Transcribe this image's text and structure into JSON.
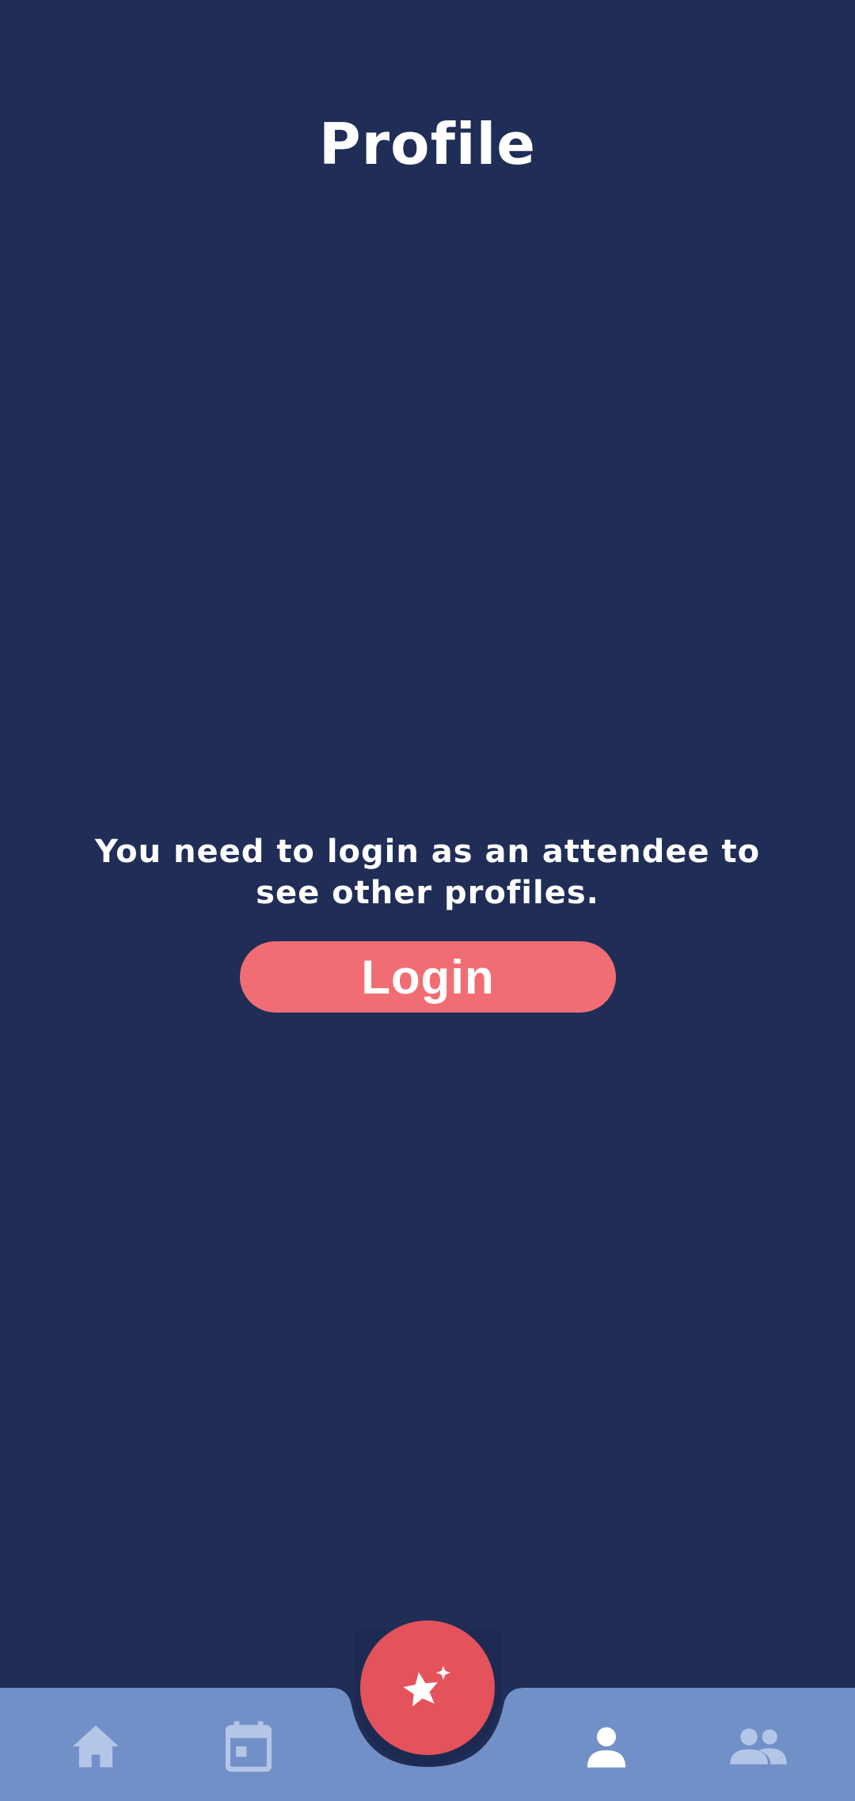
{
  "header": {
    "title": "Profile"
  },
  "main": {
    "message": "You need to login as an attendee to see other profiles.",
    "login_label": "Login"
  },
  "bottom_nav": {
    "items": [
      {
        "icon": "home-icon",
        "active": false
      },
      {
        "icon": "calendar-icon",
        "active": false
      },
      {
        "icon": "sparkle-star-icon",
        "active": false
      },
      {
        "icon": "person-icon",
        "active": true
      },
      {
        "icon": "people-icon",
        "active": false
      }
    ]
  },
  "colors": {
    "background": "#202d56",
    "nav_background": "#7190c7",
    "nav_icon_inactive": "#b4c6e8",
    "nav_icon_active": "#ffffff",
    "login_button": "#f06e73",
    "fab": "#e4525c"
  }
}
